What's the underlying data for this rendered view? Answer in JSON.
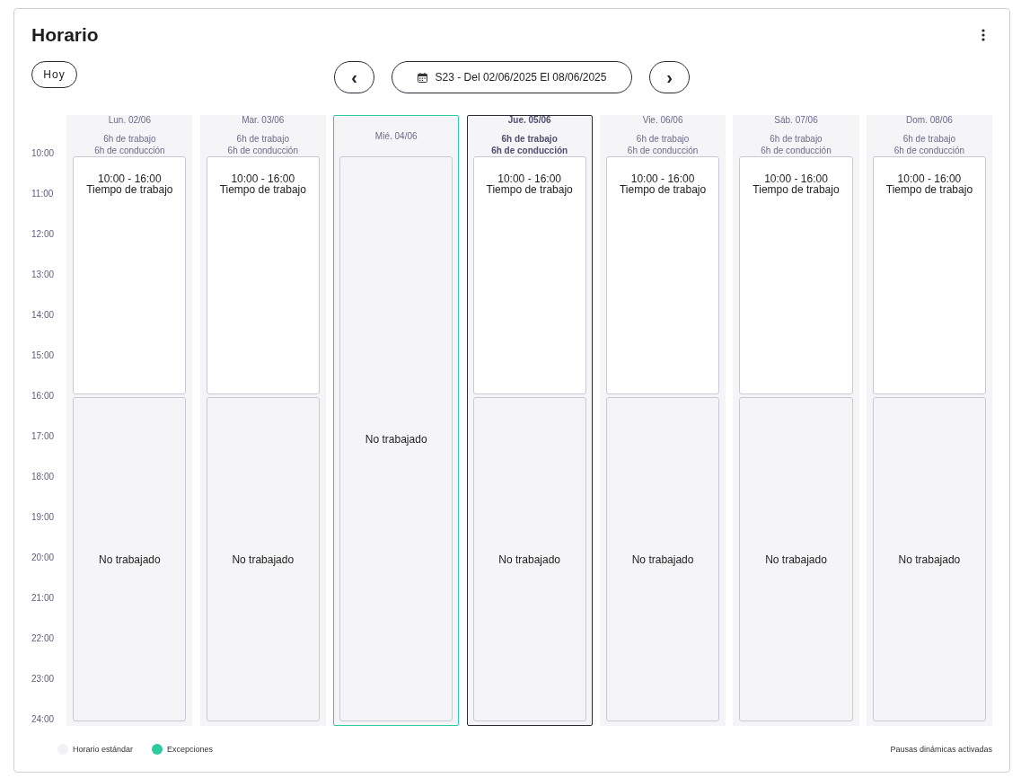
{
  "title": "Horario",
  "toolbar": {
    "today": "Hoy",
    "prev": "‹",
    "range": "S23 - Del 02/06/2025 El 08/06/2025",
    "next": "›"
  },
  "hours": [
    "10:00",
    "11:00",
    "12:00",
    "13:00",
    "14:00",
    "15:00",
    "16:00",
    "17:00",
    "18:00",
    "19:00",
    "20:00",
    "21:00",
    "22:00",
    "23:00",
    "24:00"
  ],
  "days": [
    {
      "label": "Lun. 02/06",
      "summary": [
        "6h de trabajo",
        "6h de conducción"
      ],
      "exception": false,
      "selected": false,
      "blocks": [
        {
          "kind": "work",
          "time": "10:00 - 16:00",
          "label": "Tiempo de trabajo"
        },
        {
          "kind": "off",
          "label": "No trabajado"
        }
      ]
    },
    {
      "label": "Mar. 03/06",
      "summary": [
        "6h de trabajo",
        "6h de conducción"
      ],
      "exception": false,
      "selected": false,
      "blocks": [
        {
          "kind": "work",
          "time": "10:00 - 16:00",
          "label": "Tiempo de trabajo"
        },
        {
          "kind": "off",
          "label": "No trabajado"
        }
      ]
    },
    {
      "label": "Mié. 04/06",
      "exception": true,
      "selected": false,
      "blocks": [
        {
          "kind": "off",
          "label": "No trabajado"
        }
      ]
    },
    {
      "label": "Jue. 05/06",
      "summary": [
        "6h de trabajo",
        "6h de conducción"
      ],
      "exception": false,
      "selected": true,
      "blocks": [
        {
          "kind": "work",
          "time": "10:00 - 16:00",
          "label": "Tiempo de trabajo"
        },
        {
          "kind": "off",
          "label": "No trabajado"
        }
      ]
    },
    {
      "label": "Vie. 06/06",
      "summary": [
        "6h de trabajo",
        "6h de conducción"
      ],
      "exception": false,
      "selected": false,
      "blocks": [
        {
          "kind": "work",
          "time": "10:00 - 16:00",
          "label": "Tiempo de trabajo"
        },
        {
          "kind": "off",
          "label": "No trabajado"
        }
      ]
    },
    {
      "label": "Sáb. 07/06",
      "summary": [
        "6h de trabajo",
        "6h de conducción"
      ],
      "exception": false,
      "selected": false,
      "blocks": [
        {
          "kind": "work",
          "time": "10:00 - 16:00",
          "label": "Tiempo de trabajo"
        },
        {
          "kind": "off",
          "label": "No trabajado"
        }
      ]
    },
    {
      "label": "Dom. 08/06",
      "summary": [
        "6h de trabajo",
        "6h de conducción"
      ],
      "exception": false,
      "selected": false,
      "blocks": [
        {
          "kind": "work",
          "time": "10:00 - 16:00",
          "label": "Tiempo de trabajo"
        },
        {
          "kind": "off",
          "label": "No trabajado"
        }
      ]
    }
  ],
  "legend": [
    {
      "label": "Horario estándar",
      "color": "#f2f2f5"
    },
    {
      "label": "Excepciones",
      "color": "#2dc9a0"
    }
  ],
  "footer_note": "Pausas dinámicas activadas"
}
